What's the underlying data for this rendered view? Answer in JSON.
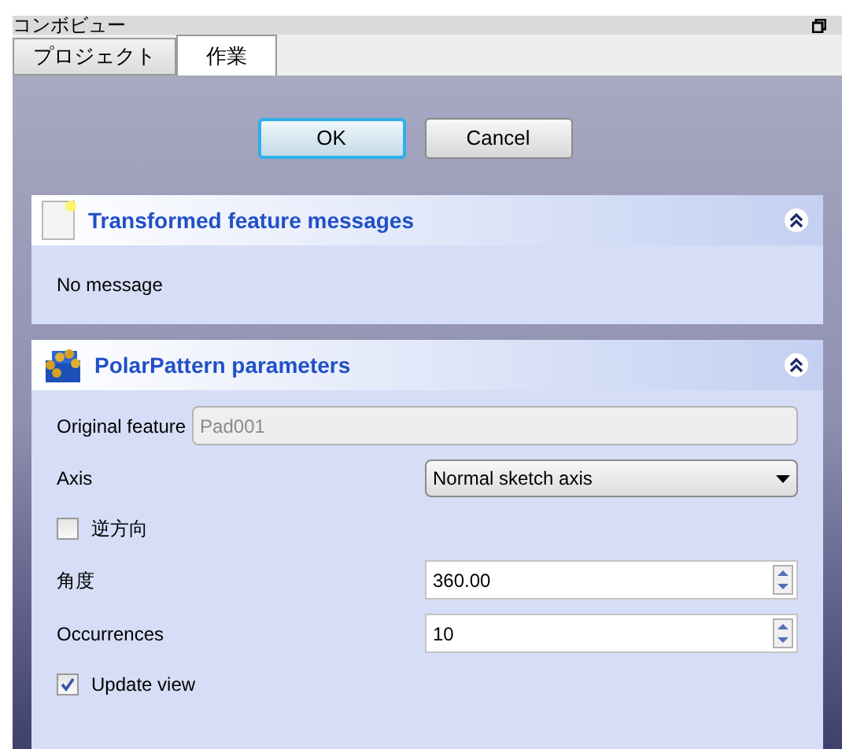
{
  "window": {
    "title": "コンボビュー"
  },
  "tabs": [
    {
      "label": "プロジェクト",
      "selected": false
    },
    {
      "label": "作業",
      "selected": true
    }
  ],
  "buttons": [
    {
      "label": "OK",
      "focused": true
    },
    {
      "label": "Cancel",
      "focused": false
    }
  ],
  "panels": [
    {
      "title": "Transformed feature messages",
      "kind": "note",
      "expanded": true,
      "rows": [
        {
          "kind": "message",
          "text": "No message"
        }
      ]
    },
    {
      "title": "PolarPattern parameters",
      "kind": "blocks",
      "expanded": true,
      "rows": [
        {
          "kind": "readonly",
          "label": "Original feature",
          "value": "Pad001"
        },
        {
          "kind": "dropdown",
          "label": "Axis",
          "value": "Normal sketch axis"
        },
        {
          "kind": "checkbox",
          "label": "逆方向",
          "checked": false
        },
        {
          "kind": "spinbox",
          "label": "角度",
          "value": "360.00"
        },
        {
          "kind": "spinbox",
          "label": "Occurrences",
          "value": "10"
        },
        {
          "kind": "checkbox",
          "label": "Update view",
          "checked": true
        }
      ]
    }
  ]
}
